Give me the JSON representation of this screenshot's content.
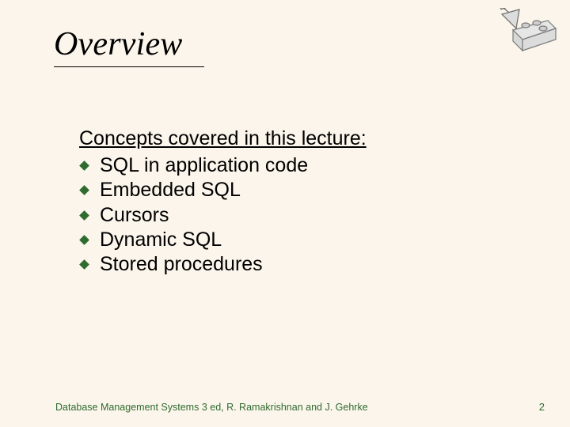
{
  "title": "Overview",
  "lead": "Concepts covered in this lecture:",
  "bullets": [
    "SQL in application code",
    "Embedded SQL",
    "Cursors",
    "Dynamic SQL",
    "Stored procedures"
  ],
  "footer": {
    "left": "Database Management Systems 3 ed,  R. Ramakrishnan and J. Gehrke",
    "page": "2"
  }
}
